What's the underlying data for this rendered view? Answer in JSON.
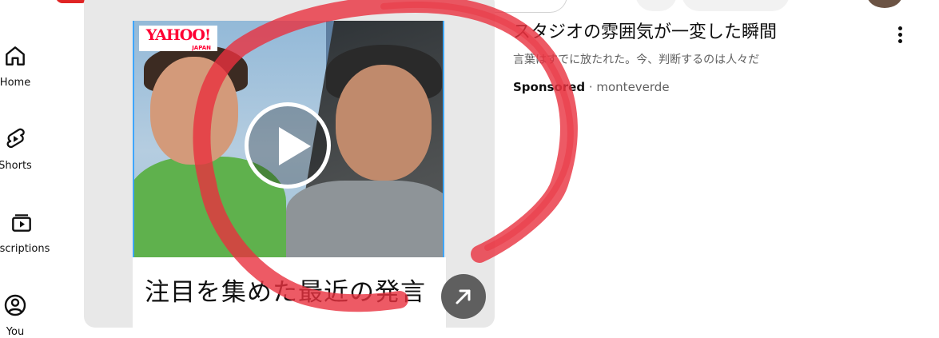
{
  "sidebar": {
    "items": [
      {
        "label": "Home",
        "icon": "home-icon"
      },
      {
        "label": "Shorts",
        "icon": "shorts-icon"
      },
      {
        "label": "oscriptions",
        "icon": "subscriptions-icon"
      },
      {
        "label": "You",
        "icon": "you-icon"
      }
    ]
  },
  "ad": {
    "logo_text": "YAHOO!",
    "logo_sub": "JAPAN",
    "caption": "注目を集めた最近の発言",
    "title": "スタジオの雰囲気が一変した瞬間",
    "description": "言葉はすでに放たれた。今、判断するのは人々だ",
    "sponsored_label": "Sponsored",
    "separator": " · ",
    "advertiser": "monteverde"
  },
  "colors": {
    "brand_red": "#ff0033",
    "annotation_red": "#e8313f",
    "card_bg": "#e8e8e8",
    "highlight_border": "#3ea6ff"
  }
}
